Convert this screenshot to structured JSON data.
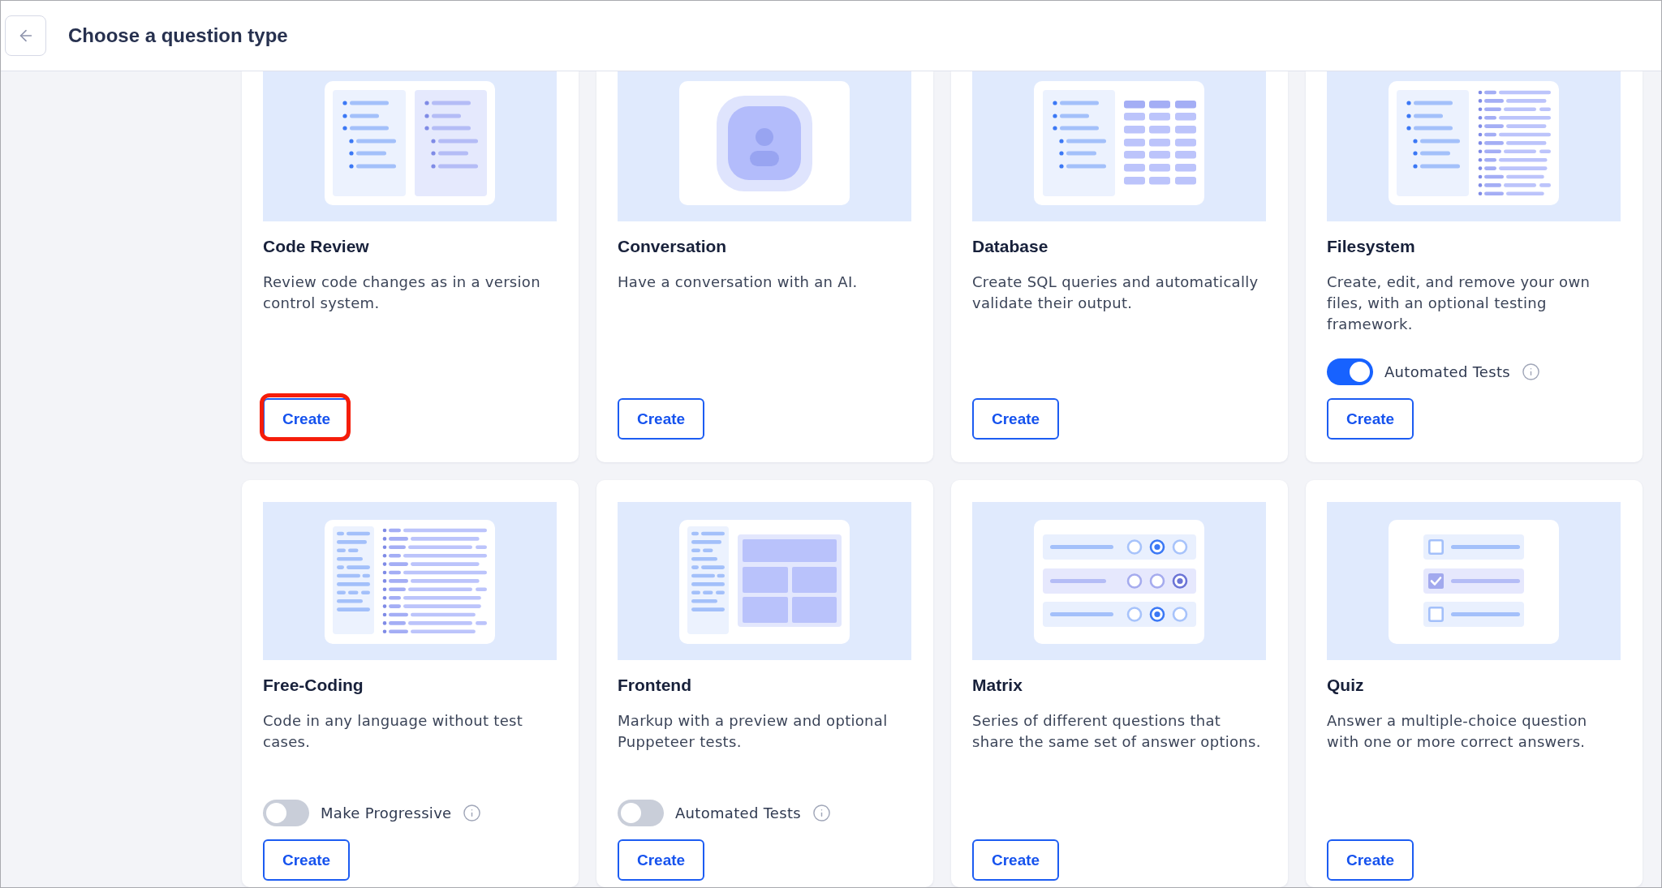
{
  "header": {
    "title": "Choose a question type"
  },
  "cards": [
    {
      "kind": "code-review",
      "title": "Code Review",
      "description": "Review code changes as in a version control system.",
      "button": {
        "label": "Create",
        "highlighted": true
      }
    },
    {
      "kind": "conversation",
      "title": "Conversation",
      "description": "Have a conversation with an AI.",
      "button": {
        "label": "Create",
        "highlighted": false
      }
    },
    {
      "kind": "database",
      "title": "Database",
      "description": "Create SQL queries and automatically validate their output.",
      "button": {
        "label": "Create",
        "highlighted": false
      }
    },
    {
      "kind": "filesystem",
      "title": "Filesystem",
      "description": "Create, edit, and remove your own files, with an optional testing framework.",
      "toggle": {
        "label": "Automated Tests",
        "on": true
      },
      "button": {
        "label": "Create",
        "highlighted": false
      }
    },
    {
      "kind": "free-coding",
      "title": "Free-Coding",
      "description": "Code in any language without test cases.",
      "toggle": {
        "label": "Make Progressive",
        "on": false
      },
      "button": {
        "label": "Create",
        "highlighted": false
      }
    },
    {
      "kind": "frontend",
      "title": "Frontend",
      "description": "Markup with a preview and optional Puppeteer tests.",
      "toggle": {
        "label": "Automated Tests",
        "on": false
      },
      "button": {
        "label": "Create",
        "highlighted": false
      }
    },
    {
      "kind": "matrix",
      "title": "Matrix",
      "description": "Series of different questions that share the same set of answer options.",
      "button": {
        "label": "Create",
        "highlighted": false
      }
    },
    {
      "kind": "quiz",
      "title": "Quiz",
      "description": "Answer a multiple-choice question with one or more correct answers.",
      "button": {
        "label": "Create",
        "highlighted": false
      }
    }
  ]
}
